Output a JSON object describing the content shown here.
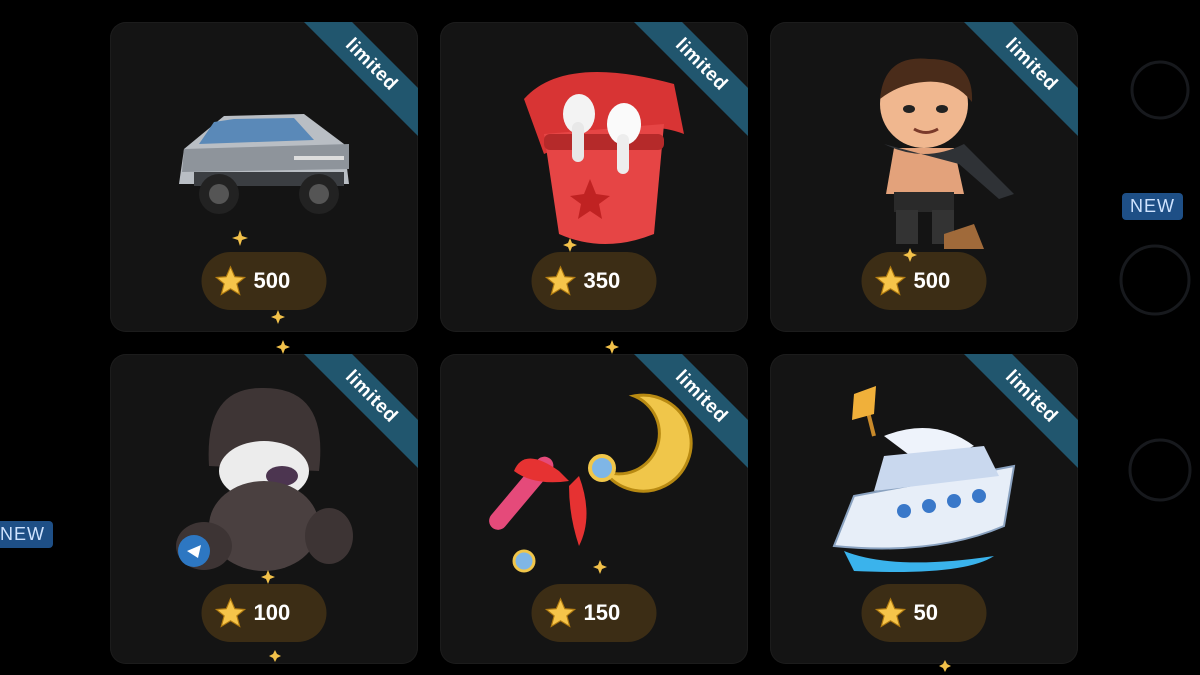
{
  "side_badges": {
    "right_badge": "NEW",
    "left_badge": "NEW"
  },
  "colors": {
    "card_bg": "#141414",
    "ribbon": "#21566e",
    "price_pill": "#5c4216",
    "star": "#f6c54a",
    "new_badge": "#1e4f86"
  },
  "gifts": [
    {
      "ribbon": "limited",
      "price": "500",
      "icon": "cybertruck-icon"
    },
    {
      "ribbon": "limited",
      "price": "350",
      "icon": "earbuds-case-icon"
    },
    {
      "ribbon": "limited",
      "price": "500",
      "icon": "hero-figure-icon"
    },
    {
      "ribbon": "limited",
      "price": "100",
      "icon": "hooded-bear-icon"
    },
    {
      "ribbon": "limited",
      "price": "150",
      "icon": "moon-wand-icon"
    },
    {
      "ribbon": "limited",
      "price": "50",
      "icon": "yacht-icon"
    }
  ]
}
